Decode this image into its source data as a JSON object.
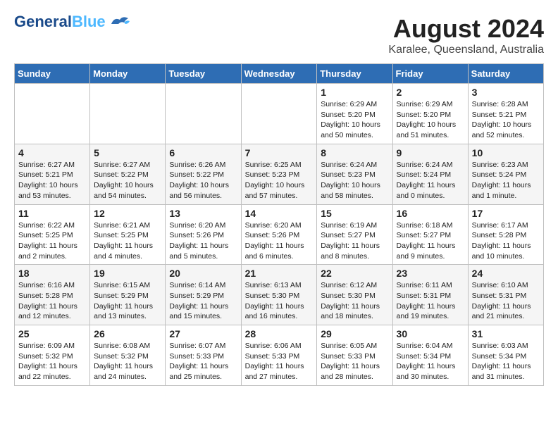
{
  "logo": {
    "line1": "General",
    "line2": "Blue"
  },
  "title": "August 2024",
  "location": "Karalee, Queensland, Australia",
  "days_of_week": [
    "Sunday",
    "Monday",
    "Tuesday",
    "Wednesday",
    "Thursday",
    "Friday",
    "Saturday"
  ],
  "weeks": [
    [
      {
        "num": "",
        "info": ""
      },
      {
        "num": "",
        "info": ""
      },
      {
        "num": "",
        "info": ""
      },
      {
        "num": "",
        "info": ""
      },
      {
        "num": "1",
        "info": "Sunrise: 6:29 AM\nSunset: 5:20 PM\nDaylight: 10 hours\nand 50 minutes."
      },
      {
        "num": "2",
        "info": "Sunrise: 6:29 AM\nSunset: 5:20 PM\nDaylight: 10 hours\nand 51 minutes."
      },
      {
        "num": "3",
        "info": "Sunrise: 6:28 AM\nSunset: 5:21 PM\nDaylight: 10 hours\nand 52 minutes."
      }
    ],
    [
      {
        "num": "4",
        "info": "Sunrise: 6:27 AM\nSunset: 5:21 PM\nDaylight: 10 hours\nand 53 minutes."
      },
      {
        "num": "5",
        "info": "Sunrise: 6:27 AM\nSunset: 5:22 PM\nDaylight: 10 hours\nand 54 minutes."
      },
      {
        "num": "6",
        "info": "Sunrise: 6:26 AM\nSunset: 5:22 PM\nDaylight: 10 hours\nand 56 minutes."
      },
      {
        "num": "7",
        "info": "Sunrise: 6:25 AM\nSunset: 5:23 PM\nDaylight: 10 hours\nand 57 minutes."
      },
      {
        "num": "8",
        "info": "Sunrise: 6:24 AM\nSunset: 5:23 PM\nDaylight: 10 hours\nand 58 minutes."
      },
      {
        "num": "9",
        "info": "Sunrise: 6:24 AM\nSunset: 5:24 PM\nDaylight: 11 hours\nand 0 minutes."
      },
      {
        "num": "10",
        "info": "Sunrise: 6:23 AM\nSunset: 5:24 PM\nDaylight: 11 hours\nand 1 minute."
      }
    ],
    [
      {
        "num": "11",
        "info": "Sunrise: 6:22 AM\nSunset: 5:25 PM\nDaylight: 11 hours\nand 2 minutes."
      },
      {
        "num": "12",
        "info": "Sunrise: 6:21 AM\nSunset: 5:25 PM\nDaylight: 11 hours\nand 4 minutes."
      },
      {
        "num": "13",
        "info": "Sunrise: 6:20 AM\nSunset: 5:26 PM\nDaylight: 11 hours\nand 5 minutes."
      },
      {
        "num": "14",
        "info": "Sunrise: 6:20 AM\nSunset: 5:26 PM\nDaylight: 11 hours\nand 6 minutes."
      },
      {
        "num": "15",
        "info": "Sunrise: 6:19 AM\nSunset: 5:27 PM\nDaylight: 11 hours\nand 8 minutes."
      },
      {
        "num": "16",
        "info": "Sunrise: 6:18 AM\nSunset: 5:27 PM\nDaylight: 11 hours\nand 9 minutes."
      },
      {
        "num": "17",
        "info": "Sunrise: 6:17 AM\nSunset: 5:28 PM\nDaylight: 11 hours\nand 10 minutes."
      }
    ],
    [
      {
        "num": "18",
        "info": "Sunrise: 6:16 AM\nSunset: 5:28 PM\nDaylight: 11 hours\nand 12 minutes."
      },
      {
        "num": "19",
        "info": "Sunrise: 6:15 AM\nSunset: 5:29 PM\nDaylight: 11 hours\nand 13 minutes."
      },
      {
        "num": "20",
        "info": "Sunrise: 6:14 AM\nSunset: 5:29 PM\nDaylight: 11 hours\nand 15 minutes."
      },
      {
        "num": "21",
        "info": "Sunrise: 6:13 AM\nSunset: 5:30 PM\nDaylight: 11 hours\nand 16 minutes."
      },
      {
        "num": "22",
        "info": "Sunrise: 6:12 AM\nSunset: 5:30 PM\nDaylight: 11 hours\nand 18 minutes."
      },
      {
        "num": "23",
        "info": "Sunrise: 6:11 AM\nSunset: 5:31 PM\nDaylight: 11 hours\nand 19 minutes."
      },
      {
        "num": "24",
        "info": "Sunrise: 6:10 AM\nSunset: 5:31 PM\nDaylight: 11 hours\nand 21 minutes."
      }
    ],
    [
      {
        "num": "25",
        "info": "Sunrise: 6:09 AM\nSunset: 5:32 PM\nDaylight: 11 hours\nand 22 minutes."
      },
      {
        "num": "26",
        "info": "Sunrise: 6:08 AM\nSunset: 5:32 PM\nDaylight: 11 hours\nand 24 minutes."
      },
      {
        "num": "27",
        "info": "Sunrise: 6:07 AM\nSunset: 5:33 PM\nDaylight: 11 hours\nand 25 minutes."
      },
      {
        "num": "28",
        "info": "Sunrise: 6:06 AM\nSunset: 5:33 PM\nDaylight: 11 hours\nand 27 minutes."
      },
      {
        "num": "29",
        "info": "Sunrise: 6:05 AM\nSunset: 5:33 PM\nDaylight: 11 hours\nand 28 minutes."
      },
      {
        "num": "30",
        "info": "Sunrise: 6:04 AM\nSunset: 5:34 PM\nDaylight: 11 hours\nand 30 minutes."
      },
      {
        "num": "31",
        "info": "Sunrise: 6:03 AM\nSunset: 5:34 PM\nDaylight: 11 hours\nand 31 minutes."
      }
    ]
  ]
}
